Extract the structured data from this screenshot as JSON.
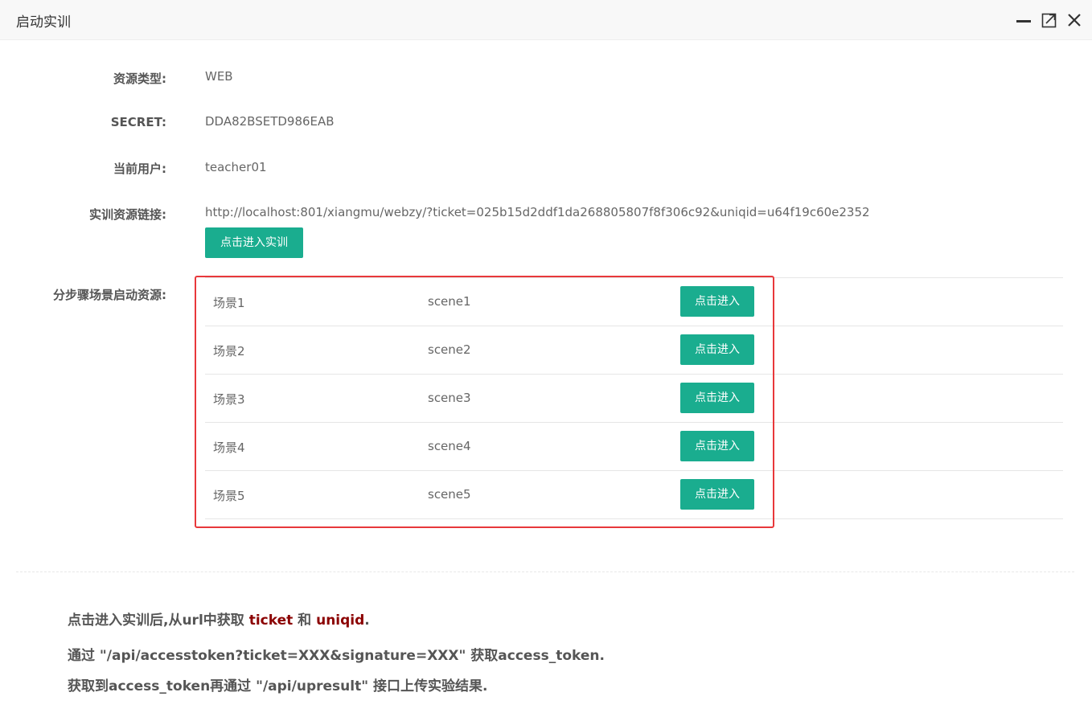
{
  "window": {
    "title": "启动实训",
    "controls": [
      {
        "icon": "minimize-icon"
      },
      {
        "icon": "maximize-icon"
      },
      {
        "icon": "close-icon"
      }
    ]
  },
  "info": {
    "resource_type_label": "资源类型:",
    "resource_type_value": "WEB",
    "secret_label": "SECRET:",
    "secret_value": "DDA82BSETD986EAB",
    "user_label": "当前用户:",
    "user_value": "teacher01",
    "link_label": "实训资源链接:",
    "link_value": "http://localhost:801/xiangmu/webzy/?ticket=025b15d2ddf1da268805807f8f306c92&uniqid=u64f19c60e2352",
    "enter_button": "点击进入实训"
  },
  "scenes": {
    "label": "分步骤场景启动资源:",
    "rows": [
      {
        "name": "场景1",
        "code": "scene1",
        "button": "点击进入"
      },
      {
        "name": "场景2",
        "code": "scene2",
        "button": "点击进入"
      },
      {
        "name": "场景3",
        "code": "scene3",
        "button": "点击进入"
      },
      {
        "name": "场景4",
        "code": "scene4",
        "button": "点击进入"
      },
      {
        "name": "场景5",
        "code": "scene5",
        "button": "点击进入"
      }
    ]
  },
  "notes": {
    "line1_prefix": "点击进入实训后,从url中获取 ",
    "line1_ticket": "ticket",
    "line1_and": " 和 ",
    "line1_uniqid": "uniqid",
    "line1_suffix": ".",
    "line2": "通过 \"/api/accesstoken?ticket=XXX&signature=XXX\" 获取access_token.",
    "line3": "获取到access_token再通过 \"/api/upresult\" 接口上传实验结果."
  },
  "colors": {
    "accent": "#1aad8f",
    "highlight_border": "#e8383b",
    "keyword": "#8b0000"
  }
}
